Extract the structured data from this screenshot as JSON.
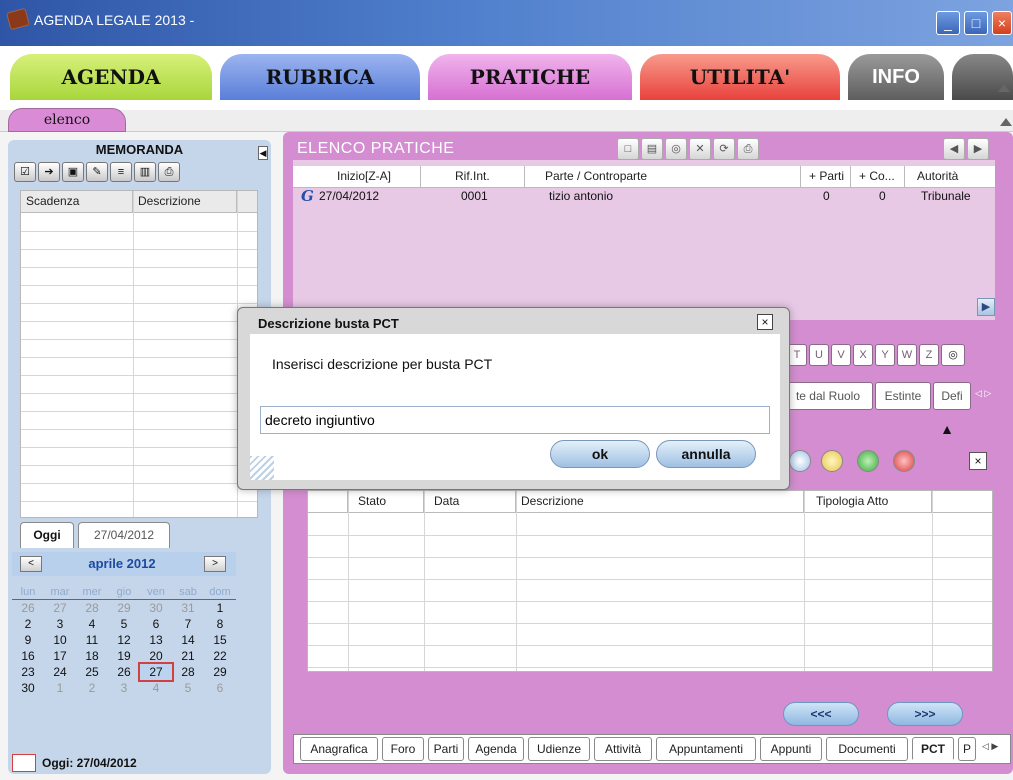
{
  "window": {
    "title": "AGENDA LEGALE 2013 -"
  },
  "main_tabs": [
    {
      "label": "AGENDA",
      "color": "#bde45a"
    },
    {
      "label": "RUBRICA",
      "color": "#6d8de0"
    },
    {
      "label": "PRATICHE",
      "color": "#e58be0"
    },
    {
      "label": "UTILITA'",
      "color": "#f05a5a"
    },
    {
      "label": "INFO",
      "color": "#6e6e6e"
    }
  ],
  "subtab": {
    "label": "elenco"
  },
  "memoranda": {
    "title": "MEMORANDA",
    "columns": [
      "Scadenza",
      "Descrizione"
    ]
  },
  "calendar": {
    "today_tab": "Oggi",
    "date_tab": "27/04/2012",
    "month": "aprile 2012",
    "prev": "<",
    "next": ">",
    "weekdays": [
      "lun",
      "mar",
      "mer",
      "gio",
      "ven",
      "sab",
      "dom"
    ],
    "weeks": [
      [
        "26",
        "27",
        "28",
        "29",
        "30",
        "31",
        "1"
      ],
      [
        "2",
        "3",
        "4",
        "5",
        "6",
        "7",
        "8"
      ],
      [
        "9",
        "10",
        "11",
        "12",
        "13",
        "14",
        "15"
      ],
      [
        "16",
        "17",
        "18",
        "19",
        "20",
        "21",
        "22"
      ],
      [
        "23",
        "24",
        "25",
        "26",
        "27",
        "28",
        "29"
      ],
      [
        "30",
        "1",
        "2",
        "3",
        "4",
        "5",
        "6"
      ]
    ],
    "today_label": "Oggi: 27/04/2012"
  },
  "pratiche": {
    "title": "ELENCO PRATICHE",
    "columns": [
      "Inizio[Z-A]",
      "Rif.Int.",
      "Parte / Controparte",
      "+ Parti",
      "+ Co...",
      "Autorità"
    ],
    "row": {
      "icon": "G",
      "date": "27/04/2012",
      "rif": "0001",
      "parte": "tizio antonio",
      "parti": "0",
      "co": "0",
      "autorita": "Tribunale"
    },
    "letters": [
      "T",
      "U",
      "V",
      "X",
      "Y",
      "W",
      "Z"
    ],
    "section_tabs": [
      "te dal Ruolo",
      "Estinte",
      "Defi"
    ]
  },
  "pct_grid": {
    "columns": [
      "Stato",
      "Data",
      "Descrizione",
      "Tipologia Atto"
    ]
  },
  "nav": {
    "prev": "<<<",
    "next": ">>>"
  },
  "bottom_tabs": [
    "Anagrafica",
    "Foro",
    "Parti",
    "Agenda",
    "Udienze",
    "Attività",
    "Appuntamenti",
    "Appunti",
    "Documenti",
    "PCT",
    "P"
  ],
  "dialog": {
    "title": "Descrizione busta PCT",
    "prompt": "Inserisci descrizione per busta PCT",
    "input_value": "decreto ingiuntivo",
    "ok": "ok",
    "cancel": "annulla",
    "close": "×"
  }
}
